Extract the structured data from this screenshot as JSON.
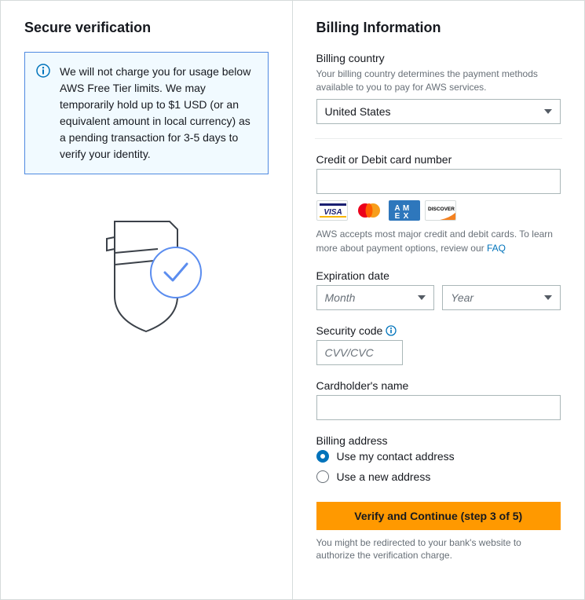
{
  "left": {
    "title": "Secure verification",
    "info_text": "We will not charge you for usage below AWS Free Tier limits. We may temporarily hold up to $1 USD (or an equivalent amount in local currency) as a pending transaction for 3-5 days to verify your identity."
  },
  "right": {
    "title": "Billing Information",
    "billing_country": {
      "label": "Billing country",
      "help": "Your billing country determines the payment methods available to you to pay for AWS services.",
      "value": "United States"
    },
    "card_number": {
      "label": "Credit or Debit card number",
      "note_prefix": "AWS accepts most major credit and debit cards. To learn more about payment options, review our ",
      "faq_label": "FAQ"
    },
    "expiration": {
      "label": "Expiration date",
      "month_placeholder": "Month",
      "year_placeholder": "Year"
    },
    "security": {
      "label": "Security code",
      "placeholder": "CVV/CVC"
    },
    "cardholder": {
      "label": "Cardholder's name"
    },
    "billing_address": {
      "label": "Billing address",
      "option_contact": "Use my contact address",
      "option_new": "Use a new address"
    },
    "submit": {
      "label": "Verify and Continue (step 3 of 5)",
      "note": "You might be redirected to your bank's website to authorize the verification charge."
    }
  }
}
